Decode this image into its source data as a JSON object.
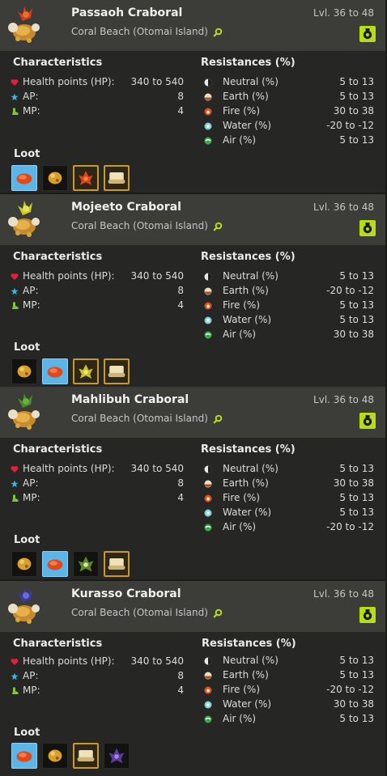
{
  "labels": {
    "characteristics": "Characteristics",
    "resistances": "Resistances (%)",
    "loot": "Loot",
    "hp": "Health points (HP):",
    "ap": "AP:",
    "mp": "MP:",
    "neutral": "Neutral (%)",
    "earth": "Earth (%)",
    "fire": "Fire (%)",
    "water": "Water (%)",
    "air": "Air (%)"
  },
  "colors": {
    "accent_green": "#b7dd1a",
    "header_bg": "#3c3c39",
    "panel_bg": "#262624",
    "highlight_slot": "#5ab6e8",
    "rare_slot_border": "#c89a2a"
  },
  "icons": {
    "hp": "heart-icon",
    "ap": "star-icon",
    "mp": "boot-icon",
    "neutral": "neutral-element-icon",
    "earth": "earth-element-icon",
    "fire": "fire-element-icon",
    "water": "water-element-icon",
    "air": "air-element-icon",
    "location": "location-magnifier-icon",
    "fight": "fight-icon"
  },
  "monsters": [
    {
      "name": "Passaoh Craboral",
      "area": "Coral Beach (Otomai Island)",
      "level": "Lvl. 36 to 48",
      "crest_color": "red",
      "hp": "340 to 540",
      "ap": "8",
      "mp": "4",
      "res": {
        "neutral": "5 to 13",
        "earth": "5 to 13",
        "fire": "30 to 38",
        "water": "-20 to -12",
        "air": "5 to 13"
      },
      "loot": [
        {
          "item": "red-coral",
          "style": "blue"
        },
        {
          "item": "craboral-claw",
          "style": "plain"
        },
        {
          "item": "red-flower",
          "style": "gold"
        },
        {
          "item": "parchment-scroll",
          "style": "gold"
        }
      ]
    },
    {
      "name": "Mojeeto Craboral",
      "area": "Coral Beach (Otomai Island)",
      "level": "Lvl. 36 to 48",
      "crest_color": "yellow",
      "hp": "340 to 540",
      "ap": "8",
      "mp": "4",
      "res": {
        "neutral": "5 to 13",
        "earth": "-20 to -12",
        "fire": "5 to 13",
        "water": "5 to 13",
        "air": "30 to 38"
      },
      "loot": [
        {
          "item": "craboral-claw",
          "style": "plain"
        },
        {
          "item": "red-coral",
          "style": "blue"
        },
        {
          "item": "yellow-flower",
          "style": "gold"
        },
        {
          "item": "parchment-scroll",
          "style": "gold"
        }
      ]
    },
    {
      "name": "Mahlibuh Craboral",
      "area": "Coral Beach (Otomai Island)",
      "level": "Lvl. 36 to 48",
      "crest_color": "green",
      "hp": "340 to 540",
      "ap": "8",
      "mp": "4",
      "res": {
        "neutral": "5 to 13",
        "earth": "30 to 38",
        "fire": "5 to 13",
        "water": "5 to 13",
        "air": "-20 to -12"
      },
      "loot": [
        {
          "item": "craboral-claw",
          "style": "plain"
        },
        {
          "item": "red-coral",
          "style": "blue"
        },
        {
          "item": "green-flower",
          "style": "plain"
        },
        {
          "item": "parchment-scroll",
          "style": "gold"
        }
      ]
    },
    {
      "name": "Kurasso Craboral",
      "area": "Coral Beach (Otomai Island)",
      "level": "Lvl. 36 to 48",
      "crest_color": "blue",
      "hp": "340 to 540",
      "ap": "8",
      "mp": "4",
      "res": {
        "neutral": "5 to 13",
        "earth": "5 to 13",
        "fire": "-20 to -12",
        "water": "30 to 38",
        "air": "5 to 13"
      },
      "loot": [
        {
          "item": "red-coral",
          "style": "blue"
        },
        {
          "item": "craboral-claw",
          "style": "plain"
        },
        {
          "item": "parchment-scroll",
          "style": "gold"
        },
        {
          "item": "purple-flower",
          "style": "plain"
        }
      ]
    }
  ]
}
